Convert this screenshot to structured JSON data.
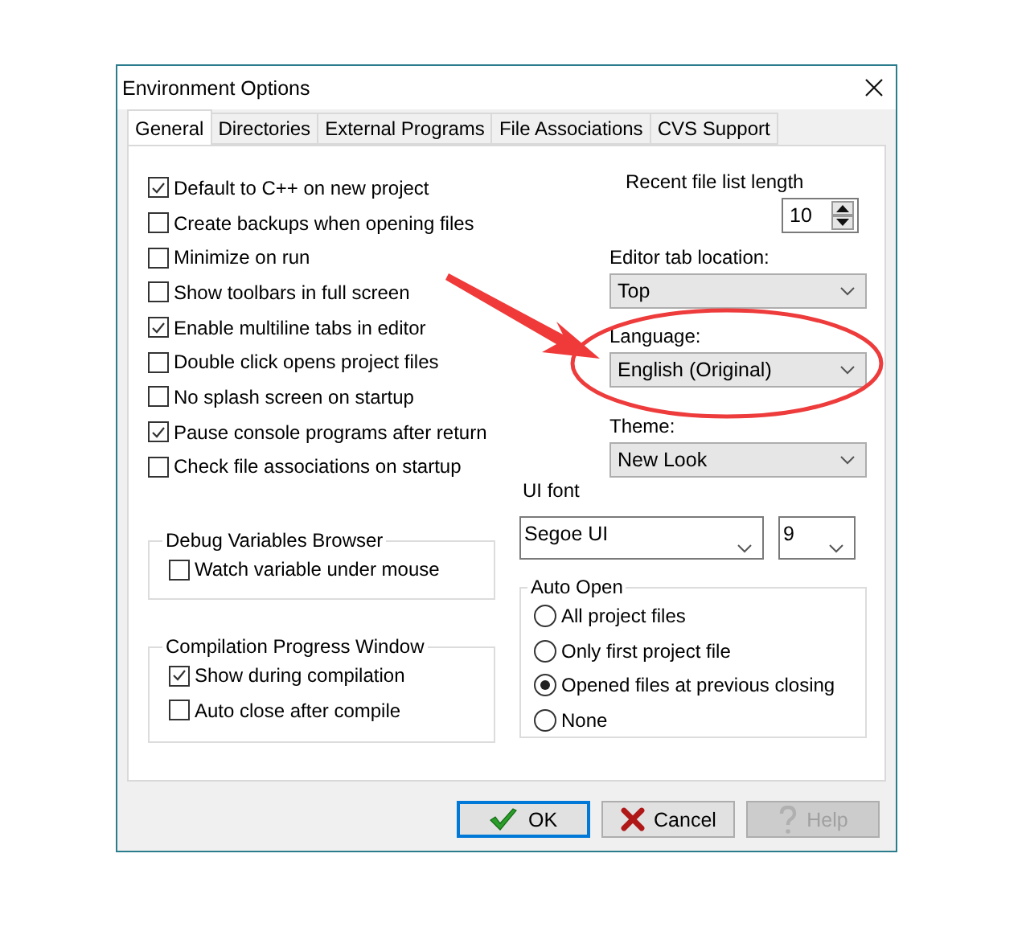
{
  "window": {
    "title": "Environment Options"
  },
  "tabs": [
    {
      "label": "General",
      "selected": true
    },
    {
      "label": "Directories",
      "selected": false
    },
    {
      "label": "External Programs",
      "selected": false
    },
    {
      "label": "File Associations",
      "selected": false
    },
    {
      "label": "CVS Support",
      "selected": false
    }
  ],
  "options": [
    {
      "label": "Default to C++ on new project",
      "checked": true
    },
    {
      "label": "Create backups when opening files",
      "checked": false
    },
    {
      "label": "Minimize on run",
      "checked": false
    },
    {
      "label": "Show toolbars in full screen",
      "checked": false
    },
    {
      "label": "Enable multiline tabs in editor",
      "checked": true
    },
    {
      "label": "Double click opens project files",
      "checked": false
    },
    {
      "label": "No splash screen on startup",
      "checked": false
    },
    {
      "label": "Pause console programs after return",
      "checked": true
    },
    {
      "label": "Check file associations on startup",
      "checked": false
    }
  ],
  "recent_file_list_length": {
    "label": "Recent file list length",
    "value": "10"
  },
  "editor_tab_location": {
    "label": "Editor tab location:",
    "value": "Top"
  },
  "language": {
    "label": "Language:",
    "value": "English (Original)"
  },
  "theme": {
    "label": "Theme:",
    "value": "New Look"
  },
  "ui_font": {
    "label": "UI font",
    "font": "Segoe UI",
    "size": "9"
  },
  "debug_variables_browser": {
    "title": "Debug Variables Browser",
    "options": [
      {
        "label": "Watch variable under mouse",
        "checked": false
      }
    ]
  },
  "compilation_progress_window": {
    "title": "Compilation Progress Window",
    "options": [
      {
        "label": "Show during compilation",
        "checked": true
      },
      {
        "label": "Auto close after compile",
        "checked": false
      }
    ]
  },
  "auto_open": {
    "title": "Auto Open",
    "choices": [
      {
        "label": "All project files",
        "selected": false
      },
      {
        "label": "Only first project file",
        "selected": false
      },
      {
        "label": "Opened files at previous closing",
        "selected": true
      },
      {
        "label": "None",
        "selected": false
      }
    ]
  },
  "buttons": [
    {
      "label": "OK",
      "kind": "ok",
      "disabled": false,
      "focused": true
    },
    {
      "label": "Cancel",
      "kind": "cancel",
      "disabled": false,
      "focused": false
    },
    {
      "label": "Help",
      "kind": "help",
      "disabled": true,
      "focused": false
    }
  ]
}
